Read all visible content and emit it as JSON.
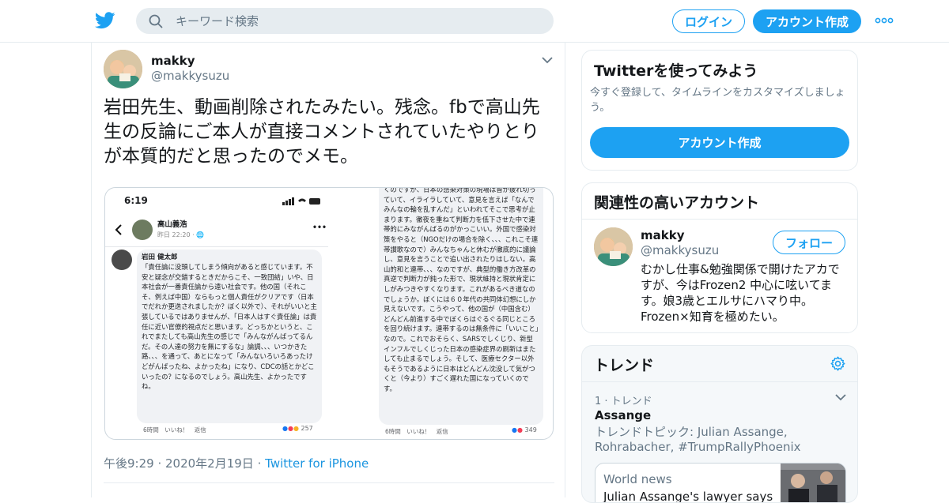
{
  "header": {
    "search_placeholder": "キーワード検索",
    "login_label": "ログイン",
    "signup_label": "アカウント作成"
  },
  "tweet": {
    "author_name": "makky",
    "author_handle": "@makkysuzu",
    "text": "岩田先生、動画削除されたみたい。残念。fbで高山先生の反論にご本人が直接コメントされていたやりとりが本質的だと思ったのでメモ。",
    "timestamp": "午後9:29 · 2020年2月19日",
    "separator": "·",
    "source": "Twitter for iPhone"
  },
  "media": {
    "time": "6:19",
    "poster_name": "高山義浩",
    "poster_meta": "昨日 22:20 · 🌐",
    "comment_author": "岩田 健太郎",
    "comment_text": "「責任論に没頭してしまう傾向があると感じています。不安と疑念が交錯するときだからこそ、一致団結」いや、日本社会が一番責任論から遠い社会です。他の国（それこそ、例えば中国）ならもっと個人責任がクリアです（日本でだれか更迭されましたか？ぼく以外で）、それがいいと主張しているではありませんが、「日本人はすぐ責任論」は責任に近い官僚的視点だと思います。どっちかというと、これでまたしても高山先生の感じで「みんながんばってるんだ。その人達の努力を無にするな」論調、、、いつかきた路、、、を通って、あとになって「みんないろいろあったけどがんばったね、よかったね」になり、CDCの話とかどこいったの？になるのでしょう。高山先生、よかったですね。",
    "left_footer": "6時間　いいね！　返信",
    "left_reactions": "257",
    "right_text": "くのですが、日本の感染対策の現場は皆が疲れ切っていて、イライラしていて、意見を言えば「なんでみんなの輪を乱すんだ」といわれてそこで思考が止まります。徹夜を重ねて判断力を低下させた中で連帯的にみながんばるのがかっこいい。外国で感染対策をやると（NGOだけの場合を除く、、、これこそ連帯讃歌なので）みんなちゃんと休むが徹底的に議論し、意見を言うことで追い出されたりはしない。高山的和と連帯、、、なのですが、典型的働き方改革の真逆で判断力が鈍った形で、現状維持と現状肯定にしがみつきやすくなります。これがあるべき道なのでしょうか。ぼくには６０年代の共同体幻想にしか見えないです。こうやって、他の国が（中国含む）どんどん前進する中でぼくらはぐるぐる同じところを回り続けます。連帯するのは無条件に「いいこと」なので。これでおそらく、SARSでしくじり、新型インフルでしくじった日本の感染症界の刷新はまたしても止まるでしょう。そして、医療セクター以外もそうであるように日本はどんどん沈没して気がつくと（今より）すごく遅れた国になっていくのです。",
    "right_footer": "6時間　いいね！　返信",
    "right_reactions": "349"
  },
  "signup_card": {
    "title": "Twitterを使ってみよう",
    "subtitle": "今すぐ登録して、タイムラインをカスタマイズしましょう。",
    "button": "アカウント作成"
  },
  "related_card": {
    "title": "関連性の高いアカウント",
    "name": "makky",
    "handle": "@makkysuzu",
    "follow_label": "フォロー",
    "bio": "むかし仕事&勉強関係で開けたアカですが、今はFrozen2 中心に呟いてます。娘3歳とエルサにハマり中。Frozen×知育を極めたい。"
  },
  "trends_card": {
    "title": "トレンド",
    "rank": "1 · トレンド",
    "trend_name": "Assange",
    "trend_desc": "トレンドトピック: Julian Assange, Rohrabacher, #TrumpRallyPhoenix",
    "news_label": "World news",
    "news_headline": "Julian Assange's lawyer says"
  },
  "colors": {
    "accent": "#1da1f2",
    "border": "#e6ecf0",
    "secondary_text": "#657786"
  }
}
